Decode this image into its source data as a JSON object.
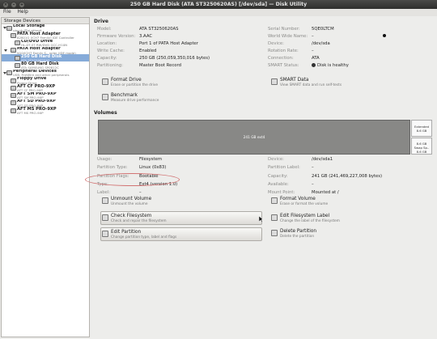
{
  "window": {
    "title": "250 GB Hard Disk (ATA ST3250620AS) [/dev/sda] — Disk Utility",
    "buttons": [
      "×",
      "–",
      "+"
    ]
  },
  "menu": [
    "File",
    "Help"
  ],
  "sidebar": {
    "header": "Storage Devices",
    "nodes": [
      {
        "title": "Local Storage",
        "sub": "ubuntu@ui.ethnet",
        "icon": "computer-icon",
        "level": 0,
        "arrow": true
      },
      {
        "title": "PATA Host Adapter",
        "sub": "82801G (ICH7 Family) IDE Controller",
        "icon": "controller-icon",
        "level": 1,
        "arrow": false
      },
      {
        "title": "CD/DVD Drive",
        "sub": "HL-DT-ST RW/DVD GCC-H10N",
        "icon": "optical-drive-icon",
        "level": 2,
        "arrow": false
      },
      {
        "title": "PATA Host Adapter",
        "sub": "N10/ICH7 Family S.. roller (IDE mode)",
        "icon": "controller-icon",
        "level": 1,
        "arrow": true
      },
      {
        "title": "250 GB Hard Disk",
        "sub": "ATA ST3250620AS",
        "icon": "hard-disk-icon",
        "level": 2,
        "selected": true
      },
      {
        "title": "80 GB Hard Disk",
        "sub": "ATA SAMSUNG SP0812C",
        "icon": "hard-disk-icon",
        "level": 2
      },
      {
        "title": "Peripheral Devices",
        "sub": "USB, FireWire and other peripherals",
        "icon": "peripheral-icon",
        "level": 0,
        "arrow": true
      },
      {
        "title": "Floppy Drive",
        "sub": "Floppy Drive",
        "icon": "floppy-icon",
        "level": 1
      },
      {
        "title": "AFT CF  PRO-9XP",
        "sub": "AFT CF  PRO-9XP",
        "icon": "card-reader-icon",
        "level": 1
      },
      {
        "title": "AFT SM  PRO-9XP",
        "sub": "AFT SM  PRO-9XP",
        "icon": "card-reader-icon",
        "level": 1
      },
      {
        "title": "AFT SD  PRO-9XP",
        "sub": "AFT SD  PRO-9XP",
        "icon": "card-reader-icon",
        "level": 1
      },
      {
        "title": "AFT MS  PRO-9XP",
        "sub": "AFT MS  PRO-9XP",
        "icon": "card-reader-icon",
        "level": 1
      }
    ]
  },
  "drive": {
    "heading": "Drive",
    "left": [
      {
        "k": "Model:",
        "v": "ATA ST3250620AS"
      },
      {
        "k": "Firmware Version:",
        "v": "3.AAC"
      },
      {
        "k": "Location:",
        "v": "Port 1 of PATA Host Adapter"
      },
      {
        "k": "Write Cache:",
        "v": "Enabled"
      },
      {
        "k": "Capacity:",
        "v": "250 GB (250,059,350,016 bytes)"
      },
      {
        "k": "Partitioning:",
        "v": "Master Boot Record"
      }
    ],
    "right": [
      {
        "k": "Serial Number:",
        "v": "5QE0LTCM"
      },
      {
        "k": "World Wide Name:",
        "v": "–"
      },
      {
        "k": "Device:",
        "v": "/dev/sda"
      },
      {
        "k": "Rotation Rate:",
        "v": "–"
      },
      {
        "k": "Connection:",
        "v": "ATA"
      },
      {
        "k": "SMART Status:",
        "v": "Disk is healthy"
      }
    ],
    "actions": [
      {
        "t": "Format Drive",
        "d": "Erase or partition the drive",
        "icon": "format-drive-icon"
      },
      {
        "t": "SMART Data",
        "d": "View SMART data and run self-tests",
        "icon": "smart-data-icon"
      },
      {
        "t": "Benchmark",
        "d": "Measure drive performance",
        "icon": "benchmark-icon"
      }
    ]
  },
  "volumes": {
    "heading": "Volumes",
    "bar": {
      "main": "241 GB ext4",
      "ext_name": "Extended",
      "ext_size": "8.6 GB",
      "swap": "8.6 GB Swap Sp..",
      "swap_size": "8.6 GB"
    },
    "left": [
      {
        "k": "Usage:",
        "v": "Filesystem"
      },
      {
        "k": "Partition Type:",
        "v": "Linux (0x83)"
      },
      {
        "k": "Partition Flags:",
        "v": "Bootable"
      },
      {
        "k": "Type:",
        "v": "Ext4 (version 1.0)"
      },
      {
        "k": "Label:",
        "v": "–"
      }
    ],
    "right": [
      {
        "k": "Device:",
        "v": "/dev/sda1"
      },
      {
        "k": "Partition Label:",
        "v": "–"
      },
      {
        "k": "Capacity:",
        "v": "241 GB (241,469,227,008 bytes)"
      },
      {
        "k": "Available:",
        "v": "–"
      },
      {
        "k": "Mount Point:",
        "v": "Mounted at /"
      }
    ],
    "actions": [
      {
        "t": "Unmount Volume",
        "d": "Unmount the volume",
        "icon": "unmount-icon"
      },
      {
        "t": "Format Volume",
        "d": "Erase or format the volume",
        "icon": "format-volume-icon"
      },
      {
        "t": "Check Filesystem",
        "d": "Check and repair the filesystem",
        "icon": "check-filesystem-icon"
      },
      {
        "t": "Edit Filesystem Label",
        "d": "Change the label of the filesystem",
        "icon": "edit-label-icon"
      },
      {
        "t": "Edit Partition",
        "d": "Change partition type, label and flags",
        "icon": "edit-partition-icon"
      },
      {
        "t": "Delete Partition",
        "d": "Delete the partition",
        "icon": "delete-partition-icon"
      }
    ]
  }
}
